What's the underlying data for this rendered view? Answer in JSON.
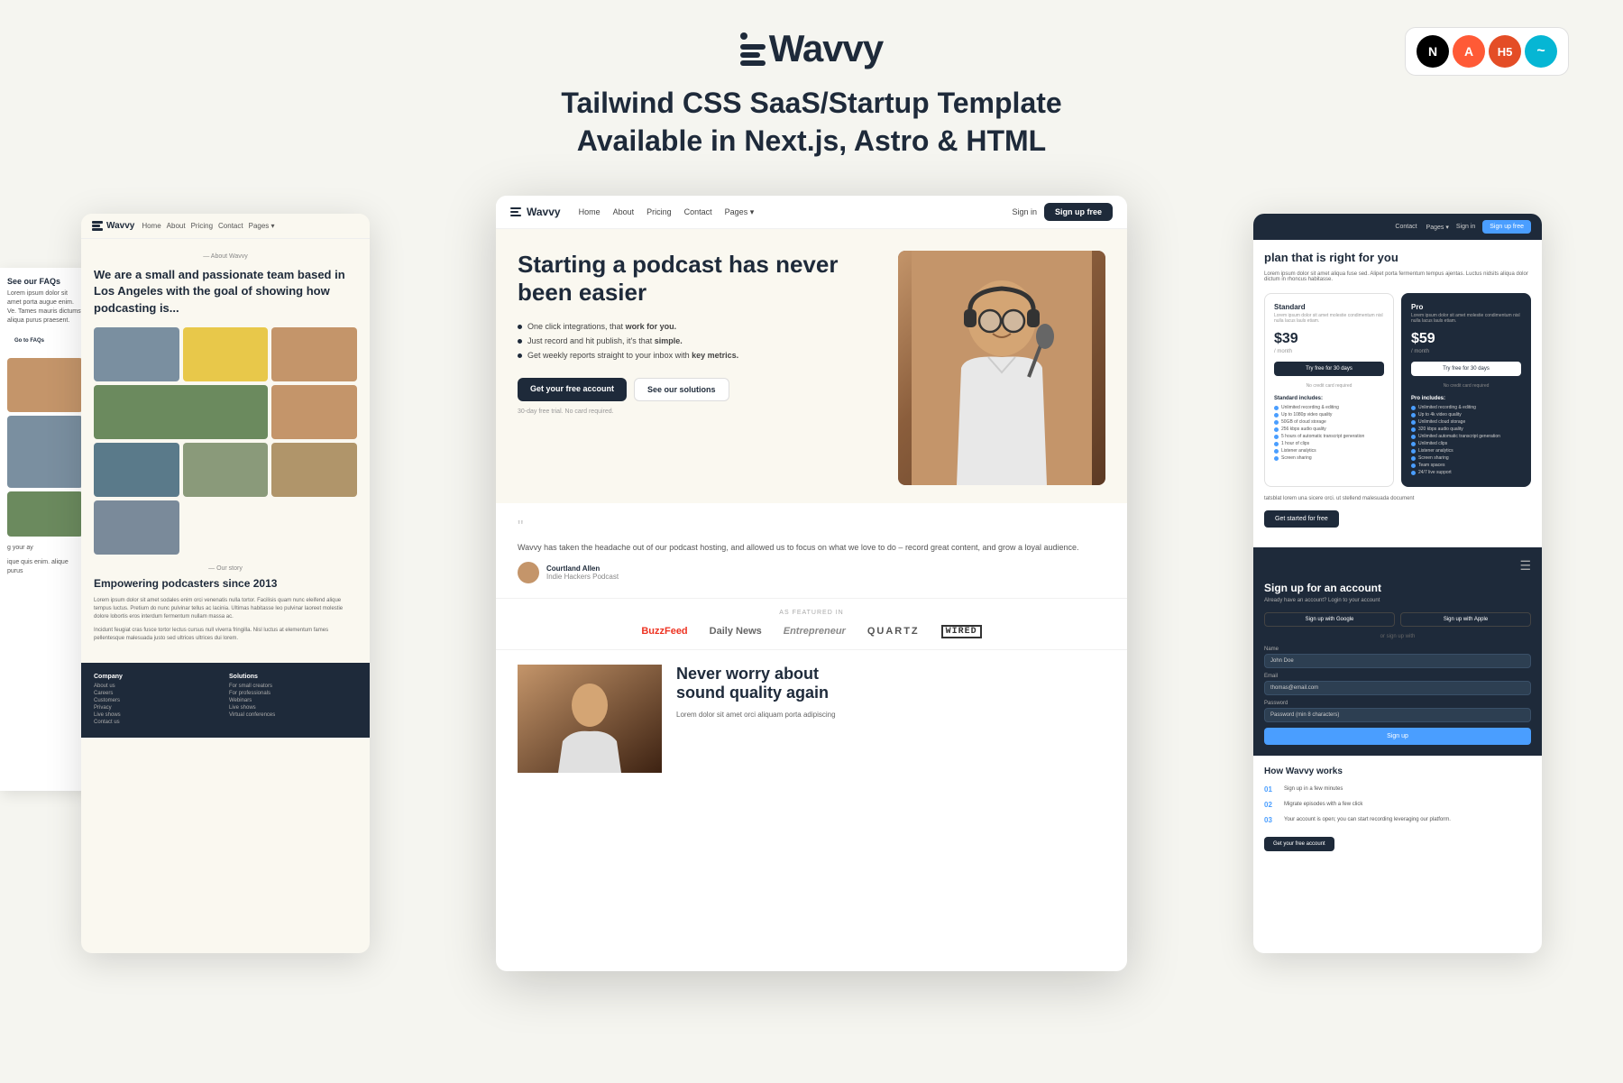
{
  "header": {
    "logo_name": "Wavvy",
    "tagline_line1": "Tailwind CSS  SaaS/Startup Template",
    "tagline_line2": "Available in Next.js, Astro & HTML"
  },
  "tech_badges": [
    "N",
    "A",
    "H5",
    "~"
  ],
  "left_card": {
    "nav_items": [
      "Home",
      "About",
      "Pricing",
      "Contact",
      "Pages"
    ],
    "about_label": "— About Wavvy",
    "about_heading": "We are a small and passionate team based in Los Angeles with the goal of showing how podcasting is...",
    "story_label": "— Our story",
    "story_heading": "Empowering podcasters since 2013",
    "story_text": "Lorem ipsum dolor sit amet sodales enim orci venenatis nulla tortor. Facilisis quam nunc eleifend alique tempus luctus. Pretium do nunc pulvinar tellus ac lacinia. Ultimas habitasse leo pulvinar laoreet molestie dolore lobortis eros interdum fermentum nullam massa ac.",
    "story_text2": "Incidunt feugiat cras fusce tortor lectus cursus null viverra fringilla. Nisl luctus at elementum fames pellentesque malesuada justo sed ultrices ultrices dui lorem.",
    "faq_heading": "See our FAQs",
    "faq_text": "Lorem ipsum dolor sit amet porta augue enim. Ve. Tames mauris dictumst aliqua purus praesent.",
    "faq_btn": "Go to FAQs",
    "footer_cols": [
      {
        "title": "Company",
        "items": [
          "About us",
          "Careers",
          "Customers",
          "Privacy",
          "Live shows",
          "Contact us"
        ]
      },
      {
        "title": "Solutions",
        "items": [
          "For small creators",
          "For professionals",
          "Webinars",
          "Live shows",
          "Virtual conferences"
        ]
      }
    ]
  },
  "center_card": {
    "nav_items": [
      "Home",
      "About",
      "Pricing",
      "Contact",
      "Pages"
    ],
    "signin_label": "Sign in",
    "signup_label": "Sign up free",
    "hero_title": "Starting a podcast has never been easier",
    "hero_bullets": [
      "One click integrations, that work for you.",
      "Just record and hit publish, it's that simple.",
      "Get weekly reports straight to your inbox with key metrics."
    ],
    "cta_primary": "Get your free account",
    "cta_secondary": "See our solutions",
    "trial_text": "30-day free trial. No card required.",
    "testimonial_quote": "Wavvy has taken the headache out of our podcast hosting, and allowed us to focus on what we love to do – record great content, and grow a loyal audience.",
    "testimonial_name": "Courtland Allen",
    "testimonial_role": "Indie Hackers Podcast",
    "featured_label": "AS FEATURED IN",
    "featured_logos": [
      "BuzzFeed",
      "Daily News",
      "Entrepreneur",
      "QUARTZ",
      "WIRED"
    ],
    "bottom_heading": "Never worry about sound quality again",
    "bottom_text": "Lorem dolor sit amet orci aliquam porta adipiscing"
  },
  "right_card": {
    "nav_links": [
      "Contact",
      "Pages"
    ],
    "signup_btn": "Sign up free",
    "pricing_title": "plan that is right for you",
    "pricing_text": "Lorem ipsum dolor sit amet aliqua fuse sed. Alipet porta fermentum tempus ajentas. Luctus nidsits aliqua dolor dictum in rhoncus habitasse.",
    "plans": [
      {
        "name": "Standard",
        "price": "$39",
        "period": "/ month",
        "desc": "Lorem ipsum dolor sit amet molestie condimentum nisl nulla lacus lauls etiam.",
        "btn": "Try free for 30 days",
        "no_credit": "No credit card required",
        "features": [
          "Unlimited recording & editing",
          "Up to 1080p video quality",
          "50GB of cloud storage",
          "256 kbps audio quality",
          "5 hours of automatic transcript generation",
          "1 hour of clips",
          "Listener analytics",
          "Screen sharing"
        ]
      },
      {
        "name": "Pro",
        "price": "$59",
        "period": "/ month",
        "desc": "Lorem ipsum dolor sit amet molestie condimentum nisl nulla lacus lauls etiam.",
        "btn": "Try free for 30 days",
        "no_credit": "No credit card required",
        "features": [
          "Unlimited recording & editing",
          "Up to 4k video quality",
          "Unlimited cloud storage",
          "320 kbps audio quality",
          "Unlimited automatic transcript generation",
          "Unlimited clips",
          "Listener analytics",
          "Screen sharing",
          "Team spaces",
          "24/7 live support"
        ]
      }
    ],
    "get_started_btn": "Get started for free",
    "signup_section": {
      "title": "Sign up for an account",
      "subtitle": "Already have an account? Login to your account",
      "google_btn": "Sign up with Google",
      "apple_btn": "Sign up with Apple",
      "divider": "or sign up with",
      "name_label": "Name",
      "name_placeholder": "John Doe",
      "email_label": "Email",
      "email_placeholder": "thomas@email.com",
      "password_label": "Password",
      "password_placeholder": "Password (min 8 characters)",
      "submit_btn": "Sign up"
    },
    "how_title": "How Wavvy works",
    "steps": [
      {
        "num": "01",
        "text": "Sign up in a few minutes"
      },
      {
        "num": "02",
        "text": "Migrate episodes with a few click"
      },
      {
        "num": "03",
        "text": "Your account is open; you can start recording leveraging our platform."
      }
    ],
    "get_account_btn": "Get your free account"
  }
}
